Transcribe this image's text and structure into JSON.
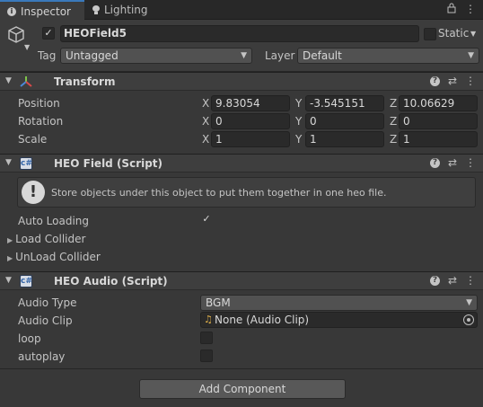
{
  "tabs": [
    {
      "label": "Inspector",
      "icon": "info-icon"
    },
    {
      "label": "Lighting",
      "icon": "lightbulb-icon"
    }
  ],
  "window_icons": {
    "lock": "lock-icon",
    "menu": "kebab-menu-icon"
  },
  "gameobject": {
    "active": true,
    "name": "HEOField5",
    "static_label": "Static",
    "static_checked": false,
    "tag_label": "Tag",
    "tag_value": "Untagged",
    "layer_label": "Layer",
    "layer_value": "Default"
  },
  "transform": {
    "title": "Transform",
    "rows": [
      {
        "label": "Position",
        "x": "9.83054",
        "y": "-3.545151",
        "z": "10.06629"
      },
      {
        "label": "Rotation",
        "x": "0",
        "y": "0",
        "z": "0"
      },
      {
        "label": "Scale",
        "x": "1",
        "y": "1",
        "z": "1"
      }
    ],
    "axis": {
      "x": "X",
      "y": "Y",
      "z": "Z"
    }
  },
  "heo_field": {
    "title": "HEO Field (Script)",
    "help_text": "Store objects under this object to put them together in one heo file.",
    "auto_loading_label": "Auto Loading",
    "auto_loading_checked": true,
    "load_collider_label": "Load Collider",
    "unload_collider_label": "UnLoad Collider"
  },
  "heo_audio": {
    "title": "HEO Audio (Script)",
    "audio_type_label": "Audio Type",
    "audio_type_value": "BGM",
    "audio_clip_label": "Audio Clip",
    "audio_clip_value": "None (Audio Clip)",
    "loop_label": "loop",
    "loop_checked": false,
    "autoplay_label": "autoplay",
    "autoplay_checked": false
  },
  "add_component_label": "Add Component",
  "colors": {
    "accent": "#3a79bb",
    "background": "#383838",
    "field": "#2a2a2a"
  }
}
